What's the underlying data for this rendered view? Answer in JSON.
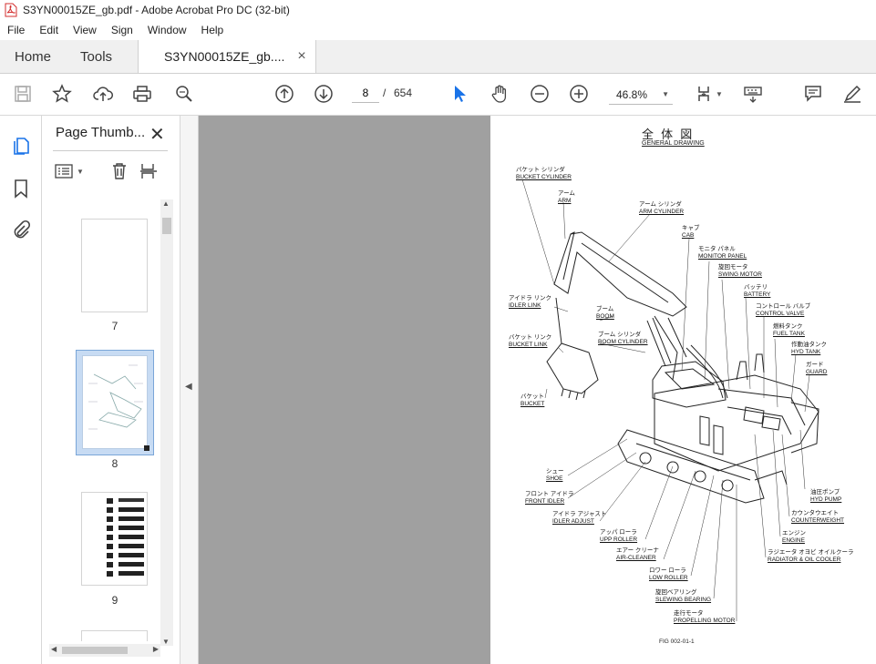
{
  "window": {
    "title": "S3YN00015ZE_gb.pdf - Adobe Acrobat Pro DC (32-bit)"
  },
  "menu": [
    "File",
    "Edit",
    "View",
    "Sign",
    "Window",
    "Help"
  ],
  "tabs": {
    "home": "Home",
    "tools": "Tools",
    "document": "S3YN00015ZE_gb....",
    "close": "×"
  },
  "nav": {
    "current_page": "8",
    "separator": "/",
    "total_pages": "654",
    "zoom": "46.8%"
  },
  "panel": {
    "title": "Page Thumb...",
    "close": "✕",
    "thumbnails": [
      {
        "label": "7"
      },
      {
        "label": "8",
        "selected": true
      },
      {
        "label": "9"
      }
    ]
  },
  "drawing": {
    "title_jp": "全 体 図",
    "title_en": "GENERAL DRAWING",
    "figure_id": "FIG 002-01-1",
    "labels": [
      {
        "jp": "バケット シリンダ",
        "en": "BUCKET CYLINDER"
      },
      {
        "jp": "アーム",
        "en": "ARM"
      },
      {
        "jp": "アーム シリンダ",
        "en": "ARM CYLINDER"
      },
      {
        "jp": "キャブ",
        "en": "CAB"
      },
      {
        "jp": "モニタ パネル",
        "en": "MONITOR PANEL"
      },
      {
        "jp": "旋回モータ",
        "en": "SWING MOTOR"
      },
      {
        "jp": "バッテリ",
        "en": "BATTERY"
      },
      {
        "jp": "コントロール バルブ",
        "en": "CONTROL VALVE"
      },
      {
        "jp": "燃料タンク",
        "en": "FUEL TANK"
      },
      {
        "jp": "作動油タンク",
        "en": "HYD TANK"
      },
      {
        "jp": "ガード",
        "en": "GUARD"
      },
      {
        "jp": "アイドラ リンク",
        "en": "IDLER LINK"
      },
      {
        "jp": "ブーム",
        "en": "BOOM"
      },
      {
        "jp": "バケット リンク",
        "en": "BUCKET LINK"
      },
      {
        "jp": "ブーム シリンダ",
        "en": "BOOM CYLINDER"
      },
      {
        "jp": "バケット",
        "en": "BUCKET"
      },
      {
        "jp": "シュー",
        "en": "SHOE"
      },
      {
        "jp": "フロント アイドラ",
        "en": "FRONT IDLER"
      },
      {
        "jp": "アイドラ アジャスト",
        "en": "IDLER ADJUST"
      },
      {
        "jp": "アッパ ローラ",
        "en": "UPP ROLLER"
      },
      {
        "jp": "エアー クリーナ",
        "en": "AIR-CLEANER"
      },
      {
        "jp": "ロワー ローラ",
        "en": "LOW ROLLER"
      },
      {
        "jp": "旋回ベアリング",
        "en": "SLEWING BEARING"
      },
      {
        "jp": "走行モータ",
        "en": "PROPELLING MOTOR"
      },
      {
        "jp": "油圧ポンプ",
        "en": "HYD PUMP"
      },
      {
        "jp": "カウンタウエイト",
        "en": "COUNTERWEIGHT"
      },
      {
        "jp": "エンジン",
        "en": "ENGINE"
      },
      {
        "jp": "ラジエータ オヨビ オイルクーラ",
        "en": "RADIATOR & OIL COOLER"
      }
    ]
  },
  "colors": {
    "accent": "#1a73e8",
    "selected_thumb_bg": "#c7dbf3",
    "pdf_red": "#d32f2f"
  }
}
